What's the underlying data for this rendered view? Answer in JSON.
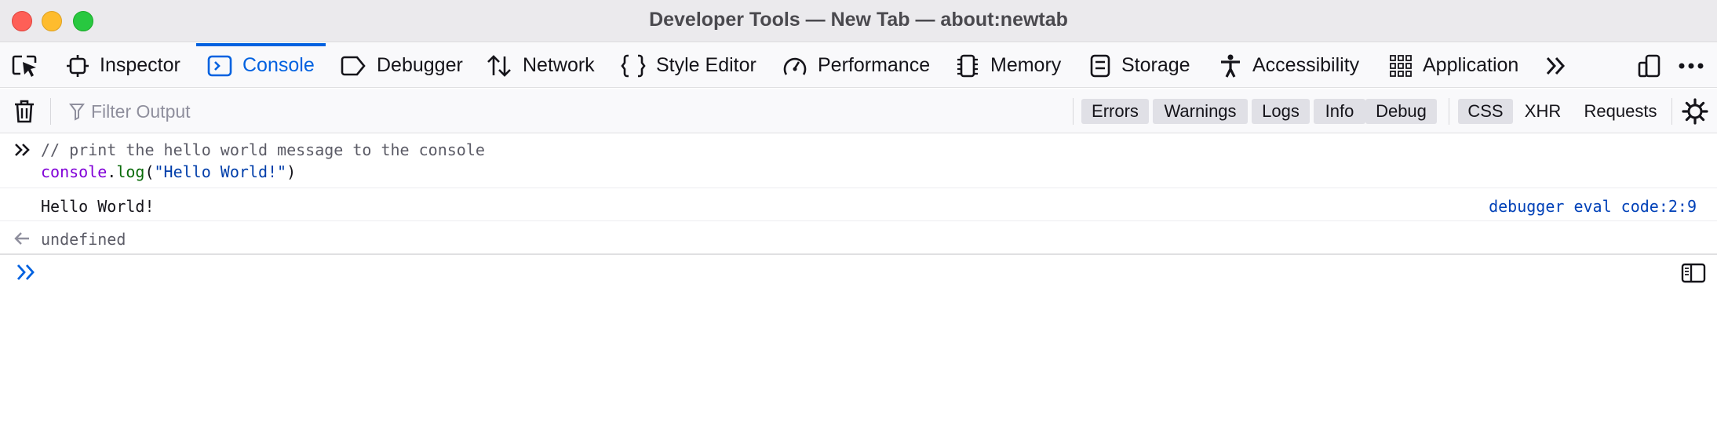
{
  "window": {
    "title": "Developer Tools — New Tab — about:newtab"
  },
  "toolbar": {
    "tabs": [
      {
        "label": "Inspector",
        "icon": "inspector-icon"
      },
      {
        "label": "Console",
        "icon": "console-icon",
        "selected": true
      },
      {
        "label": "Debugger",
        "icon": "debugger-icon"
      },
      {
        "label": "Network",
        "icon": "network-icon"
      },
      {
        "label": "Style Editor",
        "icon": "style-editor-icon"
      },
      {
        "label": "Performance",
        "icon": "performance-icon"
      },
      {
        "label": "Memory",
        "icon": "memory-icon"
      },
      {
        "label": "Storage",
        "icon": "storage-icon"
      },
      {
        "label": "Accessibility",
        "icon": "accessibility-icon"
      },
      {
        "label": "Application",
        "icon": "application-icon"
      }
    ],
    "icons": [
      "element-picker-icon",
      "more-tools-icon",
      "responsive-design-icon",
      "meatball-menu-icon"
    ]
  },
  "filter": {
    "placeholder": "Filter Output",
    "value": "",
    "levels": [
      {
        "label": "Errors",
        "active": true
      },
      {
        "label": "Warnings",
        "active": true
      },
      {
        "label": "Logs",
        "active": true
      },
      {
        "label": "Info",
        "active": true
      },
      {
        "label": "Debug",
        "active": true
      }
    ],
    "types": [
      {
        "label": "CSS",
        "active": true
      },
      {
        "label": "XHR",
        "active": false
      },
      {
        "label": "Requests",
        "active": false
      }
    ]
  },
  "console": {
    "command": {
      "comment": "// print the hello world message to the console",
      "obj": "console",
      "dot": ".",
      "fn": "log",
      "open": "(",
      "arg": "\"Hello World!\"",
      "close": ")"
    },
    "log_message": "Hello World!",
    "log_source": "debugger eval code:2:9",
    "result": "undefined",
    "input_value": ""
  },
  "colors": {
    "accent": "#0061e0",
    "keyword": "#8000d7",
    "function": "#0a6b0a",
    "string": "#003eaa",
    "link": "#0041b8"
  }
}
